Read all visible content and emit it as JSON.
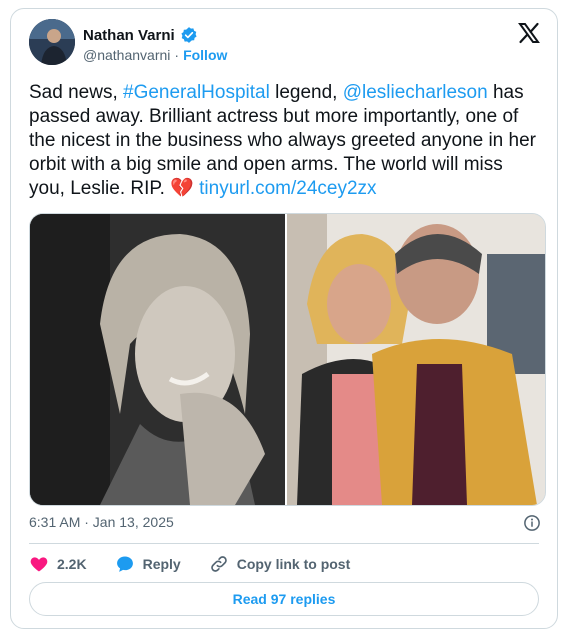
{
  "author": {
    "name": "Nathan Varni",
    "handle": "@nathanvarni",
    "separator": "·",
    "follow_label": "Follow",
    "verified_color": "#1d9bf0"
  },
  "tweet": {
    "segments": [
      {
        "text": "Sad news, ",
        "type": "text"
      },
      {
        "text": "#GeneralHospital",
        "type": "link"
      },
      {
        "text": " legend, ",
        "type": "text"
      },
      {
        "text": "@lesliecharleson",
        "type": "link"
      },
      {
        "text": "  has passed away. Brilliant actress but more importantly, one of the nicest in the business who always greeted anyone in her orbit with a big smile and open arms. The world will miss you, Leslie. RIP. ",
        "type": "text"
      },
      {
        "text": "💔",
        "type": "emoji"
      },
      {
        "text": " ",
        "type": "text"
      },
      {
        "text": "tinyurl.com/24cey2zx",
        "type": "link"
      }
    ],
    "timestamp": "6:31 AM · Jan 13, 2025"
  },
  "media": {
    "left_image": "black-and-white portrait photo",
    "right_image": "color photo of two people"
  },
  "actions": {
    "likes_count": "2.2K",
    "reply_label": "Reply",
    "copy_link_label": "Copy link to post"
  },
  "read_replies_label": "Read 97 replies",
  "colors": {
    "link": "#1d9bf0",
    "like": "#f91880",
    "muted": "#536471",
    "border": "#cfd9de"
  },
  "icons": [
    "x-logo-icon",
    "verified-badge-icon",
    "info-icon",
    "heart-icon",
    "reply-bubble-icon",
    "link-icon"
  ]
}
